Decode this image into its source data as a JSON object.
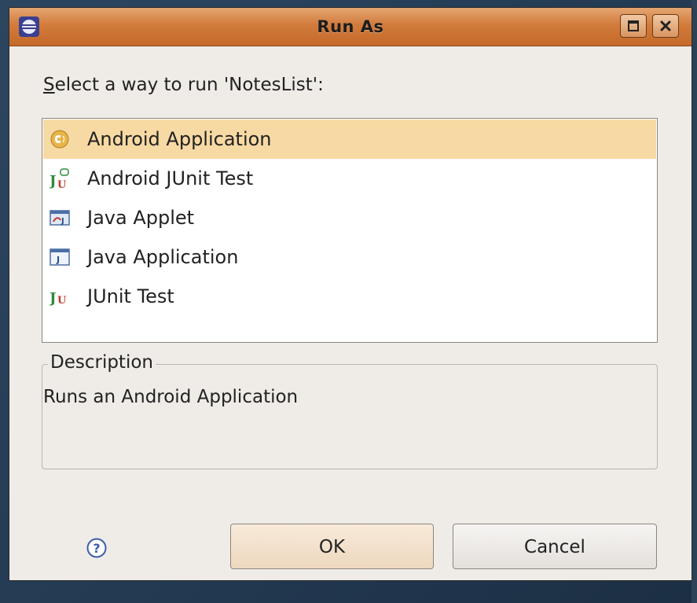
{
  "window": {
    "title": "Run As",
    "icon": "eclipse-icon",
    "controls": [
      "maximize-icon",
      "close-icon"
    ]
  },
  "prompt": {
    "mnemonic": "S",
    "rest": "elect a way to run 'NotesList':"
  },
  "launch_options": [
    {
      "label": "Android Application",
      "icon": "android-app-icon",
      "selected": true
    },
    {
      "label": "Android JUnit Test",
      "icon": "android-junit-icon",
      "selected": false
    },
    {
      "label": "Java Applet",
      "icon": "java-applet-icon",
      "selected": false
    },
    {
      "label": "Java Application",
      "icon": "java-application-icon",
      "selected": false
    },
    {
      "label": "JUnit Test",
      "icon": "junit-icon",
      "selected": false
    }
  ],
  "description": {
    "legend": "Description",
    "text": "Runs an Android Application"
  },
  "buttons": {
    "help_icon": "help-icon",
    "ok": "OK",
    "cancel": "Cancel"
  },
  "colors": {
    "titlebar": "#d27b3b",
    "selection": "#f7d9a3",
    "dialog_bg": "#efebe7"
  }
}
